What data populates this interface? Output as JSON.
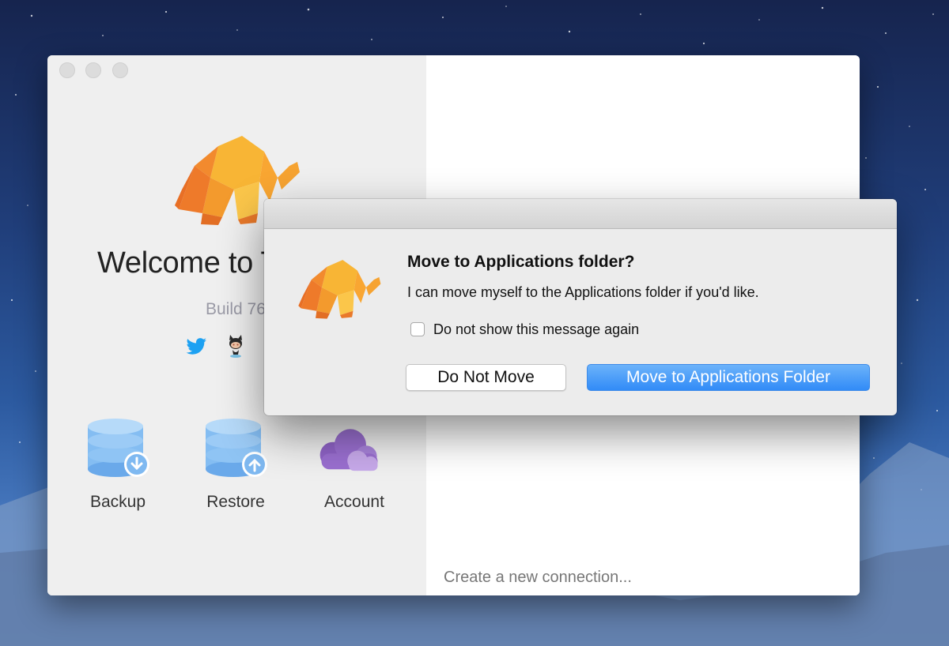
{
  "main_window": {
    "welcome_text": "Welcome to T",
    "build_text": "Build 76",
    "actions": [
      {
        "label": "Backup",
        "icon": "database-download-icon"
      },
      {
        "label": "Restore",
        "icon": "database-upload-icon"
      },
      {
        "label": "Account",
        "icon": "cloud-icon"
      }
    ],
    "create_connection": "Create a new connection..."
  },
  "dialog": {
    "title": "Move to Applications folder?",
    "message": "I can move myself to the Applications folder if you'd like.",
    "checkbox_label": "Do not show this message again",
    "checkbox_checked": false,
    "secondary_button": "Do Not Move",
    "primary_button": "Move to Applications Folder"
  },
  "colors": {
    "primary_button": "#3a8ff7",
    "database_icon": "#7db6ef",
    "cloud_icon": "#a27ad6",
    "elephant": "#f8a531",
    "twitter": "#1da1f2"
  }
}
